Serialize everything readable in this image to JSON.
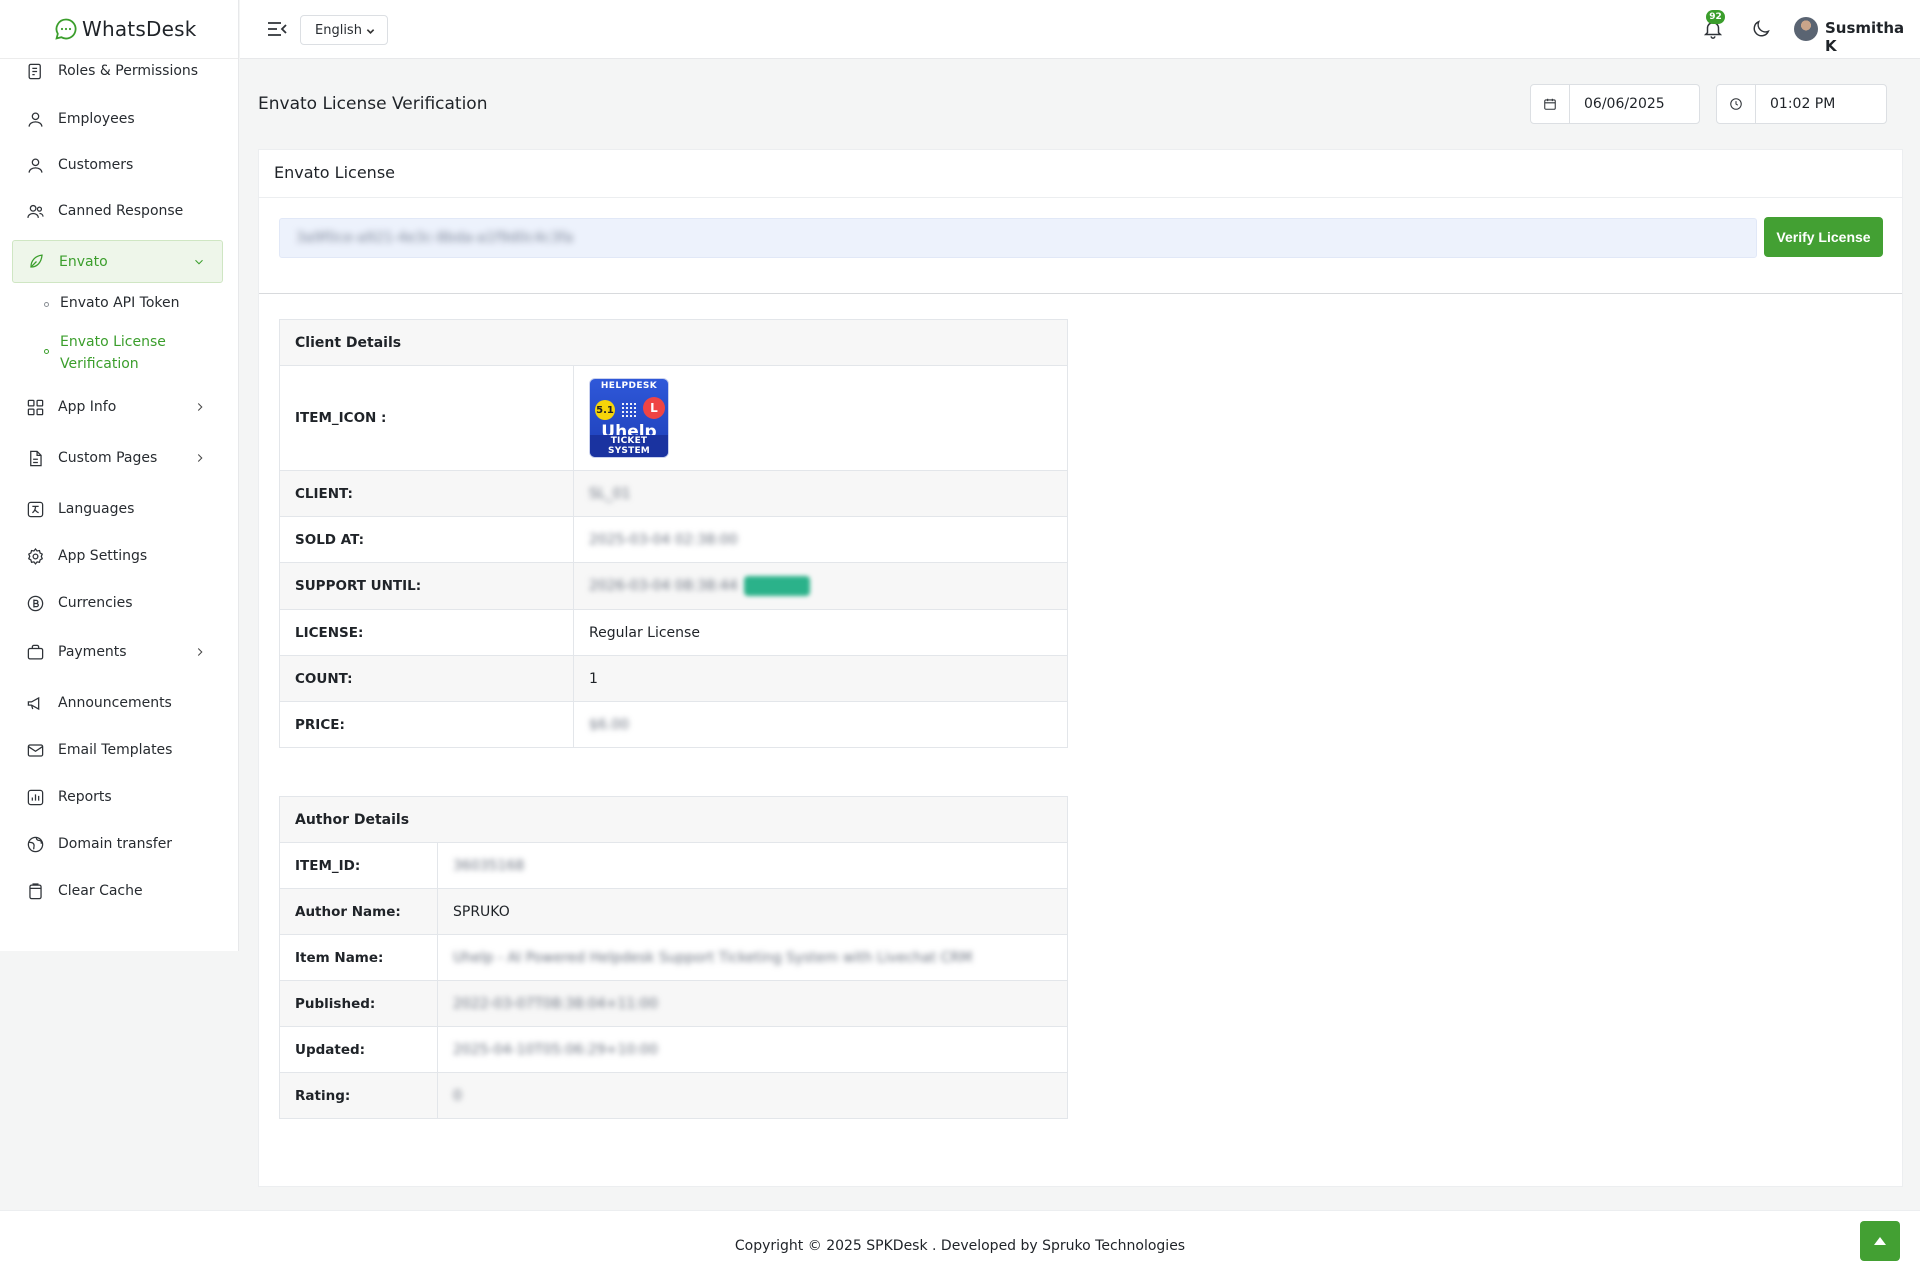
{
  "brand": {
    "name": "WhatsDesk"
  },
  "sidebar": {
    "items": [
      {
        "label": "Roles & Permissions"
      },
      {
        "label": "Employees"
      },
      {
        "label": "Customers"
      },
      {
        "label": "Canned Response"
      },
      {
        "label": "Envato"
      },
      {
        "label": "App Info"
      },
      {
        "label": "Custom Pages"
      },
      {
        "label": "Languages"
      },
      {
        "label": "App Settings"
      },
      {
        "label": "Currencies"
      },
      {
        "label": "Payments"
      },
      {
        "label": "Announcements"
      },
      {
        "label": "Email Templates"
      },
      {
        "label": "Reports"
      },
      {
        "label": "Domain transfer"
      },
      {
        "label": "Clear Cache"
      }
    ],
    "submenu": [
      {
        "label": "Envato API Token"
      },
      {
        "label": "Envato License Verification"
      }
    ]
  },
  "header": {
    "language": "English",
    "notifications_count": "92",
    "user_name": "Susmitha K"
  },
  "page": {
    "title": "Envato License Verification",
    "date": "06/06/2025",
    "time": "01:02 PM"
  },
  "card": {
    "title": "Envato License",
    "license_input_value": "3a9f0ce-a921-4e3c-8bda-a1f9d0c4c3fa",
    "verify_label": "Verify License"
  },
  "client_details": {
    "heading": "Client Details",
    "rows": [
      {
        "label": "ITEM_ICON :",
        "value": ""
      },
      {
        "label": "CLIENT:",
        "value": "SL_01"
      },
      {
        "label": "SOLD AT:",
        "value": "2025-03-04 02:38:00"
      },
      {
        "label": "SUPPORT UNTIL:",
        "value": "2026-03-04 08:38:44"
      },
      {
        "label": "LICENSE:",
        "value": "Regular License"
      },
      {
        "label": "COUNT:",
        "value": "1"
      },
      {
        "label": "PRICE:",
        "value": "$6.00"
      }
    ],
    "item_icon": {
      "top": "HELPDESK",
      "version": "5.1",
      "name": "Uhelp",
      "bottom": "TICKET SYSTEM",
      "l_glyph": "L"
    }
  },
  "author_details": {
    "heading": "Author Details",
    "rows": [
      {
        "label": "ITEM_ID:",
        "value": "36035168"
      },
      {
        "label": "Author Name:",
        "value": "SPRUKO"
      },
      {
        "label": "Item Name:",
        "value": "Uhelp - AI Powered Helpdesk Support Ticketing System with Livechat CRM"
      },
      {
        "label": "Published:",
        "value": "2022-03-07T08:38:04+11:00"
      },
      {
        "label": "Updated:",
        "value": "2025-04-10T05:06:29+10:00"
      },
      {
        "label": "Rating:",
        "value": "0"
      }
    ]
  },
  "footer": {
    "text": "Copyright © 2025 SPKDesk . Developed by Spruko Technologies"
  },
  "colors": {
    "accent": "#43a033",
    "active_bg": "#eef6ea"
  }
}
